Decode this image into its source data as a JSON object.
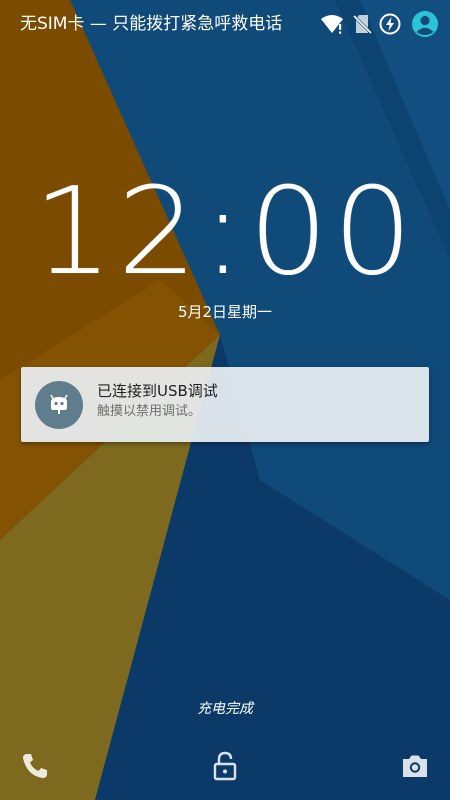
{
  "status_bar": {
    "carrier_text": "无SIM卡 — 只能拨打紧急呼救电话",
    "icons": [
      "wifi-icon",
      "no-sim-icon",
      "charging-icon",
      "user-avatar-icon"
    ]
  },
  "lockscreen": {
    "clock": "12:00",
    "date": "5月2日星期一",
    "notification": {
      "icon": "cyanogenmod-bugdroid-icon",
      "title": "已连接到USB调试",
      "text": "触摸以禁用调试。"
    },
    "charging_status": "充电完成",
    "bottom_actions": [
      "phone-icon",
      "unlock-icon",
      "camera-icon"
    ]
  },
  "colors": {
    "wallpaper_blue": "#0f4a79",
    "wallpaper_dark_blue": "#0b3660",
    "wallpaper_orange": "#7b4c00",
    "wallpaper_olive": "#7d6a1f",
    "accent_teal": "#29c4d8",
    "notification_bg": "#ecf0f4",
    "notification_icon_bg": "#5f7d8d"
  }
}
